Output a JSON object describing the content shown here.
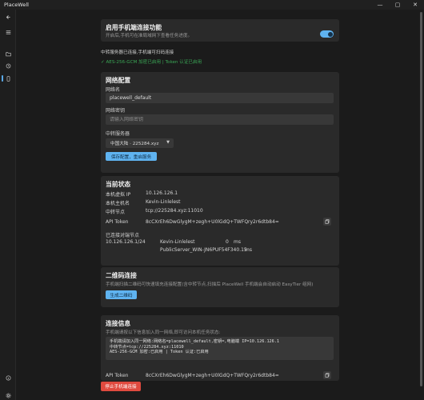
{
  "window": {
    "title": "PlaceWell",
    "controls": [
      "—",
      "▢",
      "✕"
    ]
  },
  "rail": {
    "top_icons": [
      "back-arrow-icon",
      "menu-icon"
    ],
    "nav_icons": [
      "folder-icon",
      "history-icon",
      "phone-icon"
    ],
    "bottom_icons": [
      "info-icon",
      "settings-gear-icon"
    ]
  },
  "mobile": {
    "title": "启用手机端连接功能",
    "subtitle": "开启后,手机可在准局域网下查看任务进度。",
    "enabled": true
  },
  "status": {
    "line1": "中转服务器已连接,手机端可扫码连接",
    "line2": "AES-256-GCM 加密已启用 | Token 认证已启用",
    "line2_color": "#3aa655"
  },
  "network": {
    "title": "网络配置",
    "name_label": "网络名",
    "name_value": "placewell_default",
    "password_label": "网络密钥",
    "password_placeholder": "请输入网络密钥",
    "server_label": "中转服务器",
    "server_value": "中国大陆 · 225284.xyz",
    "save_button": "保存配置，重启服务"
  },
  "current": {
    "title": "当前状态",
    "rows": [
      {
        "key": "本机虚拟 IP",
        "value": "10.126.126.1"
      },
      {
        "key": "本机主机名",
        "value": "Kevin-Linlelest"
      },
      {
        "key": "中转节点",
        "value": "tcp://225284.xyz:11010"
      },
      {
        "key": "API Token",
        "value": "8cCXrEh6DwGlygM+zegh+U0lGdQ+TWFQry2r6dtb84="
      }
    ],
    "peers_label": "已连接对端节点",
    "peers": [
      {
        "ip": "10.126.126.1/24",
        "name": "Kevin-Linlelest",
        "latency": "0",
        "unit": "ms"
      },
      {
        "ip": "",
        "name": "PublicServer_WIN-JN6PUF54F340.15",
        "latency": "",
        "unit": "ms"
      }
    ]
  },
  "qr": {
    "title": "二维码连接",
    "desc": "手机端扫描二维码可快速填充连接配置(含中转节点,扫描后 PlaceWell 手机端会自动启动 EasyTier 组网)",
    "button": "生成二维码"
  },
  "conn": {
    "title": "连接信息",
    "desc": "手机端请按以下信息加入同一网络,即可访问本机任务状态:",
    "code_lines": [
      "手机端请加入同一网络:网络名=placewell_default,密钥=,电脑端 IP=10.126.126.1",
      "中转节点=tcp://225284.xyz:11010",
      "AES-256-GCM 加密:已启用 | Token 认证:已启用"
    ],
    "token_label": "API Token",
    "token_value": "8cCXrEh6DwGlygM+zegh+U0lGdQ+TWFQry2r6dtb84="
  },
  "stop_button": "停止手机端连接",
  "colors": {
    "accent": "#5fb3f0",
    "danger": "#e04a3f",
    "card": "#2a2a2a",
    "bg": "#1b1b1b"
  }
}
